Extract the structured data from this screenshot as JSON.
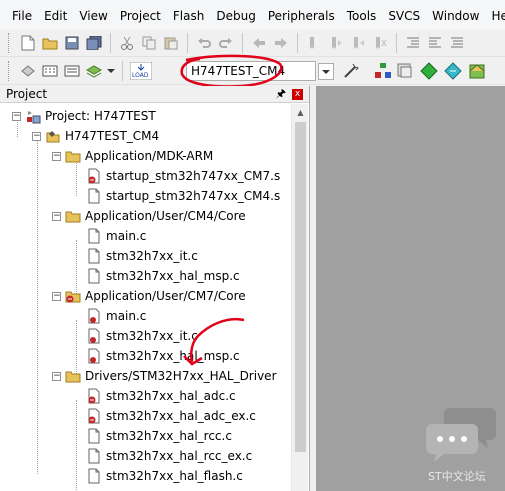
{
  "menu": [
    "File",
    "Edit",
    "View",
    "Project",
    "Flash",
    "Debug",
    "Peripherals",
    "Tools",
    "SVCS",
    "Window",
    "Help"
  ],
  "toolbar": {
    "target": "H747TEST_CM4",
    "load_label": "LOAD"
  },
  "panel": {
    "title": "Project",
    "pin": "p",
    "close": "x"
  },
  "tree": {
    "project": "Project: H747TEST",
    "target": "H747TEST_CM4",
    "groups": [
      {
        "name": "Application/MDK-ARM",
        "files": [
          "startup_stm32h747xx_CM7.s",
          "startup_stm32h747xx_CM4.s"
        ]
      },
      {
        "name": "Application/User/CM4/Core",
        "files": [
          "main.c",
          "stm32h7xx_it.c",
          "stm32h7xx_hal_msp.c"
        ]
      },
      {
        "name": "Application/User/CM7/Core",
        "files": [
          "main.c",
          "stm32h7xx_it.c",
          "stm32h7xx_hal_msp.c"
        ]
      },
      {
        "name": "Drivers/STM32H7xx_HAL_Driver",
        "files": [
          "stm32h7xx_hal_adc.c",
          "stm32h7xx_hal_adc_ex.c",
          "stm32h7xx_hal_rcc.c",
          "stm32h7xx_hal_rcc_ex.c",
          "stm32h7xx_hal_flash.c"
        ]
      }
    ]
  },
  "watermark": "ST中文论坛",
  "colors": {
    "annotation": "#e0001a",
    "editor_bg": "#a0a0a0",
    "folder": "#e8c25a"
  }
}
